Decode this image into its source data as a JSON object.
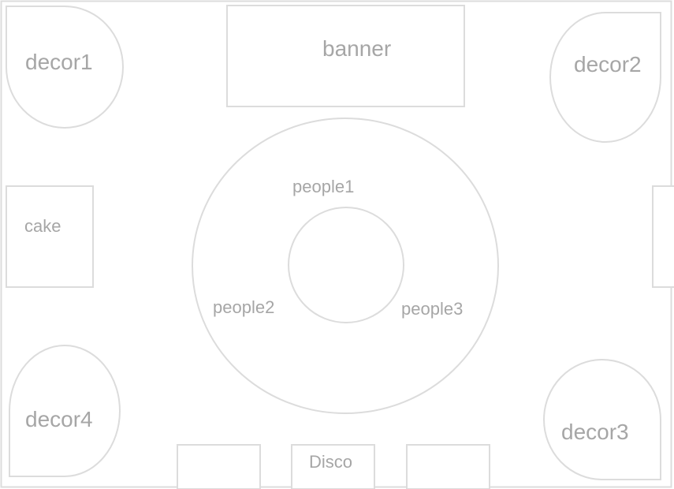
{
  "labels": {
    "decor1": "decor1",
    "decor2": "decor2",
    "decor3": "decor3",
    "decor4": "decor4",
    "banner": "banner",
    "cake": "cake",
    "people1": "people1",
    "people2": "people2",
    "people3": "people3",
    "disco": "Disco"
  },
  "colors": {
    "stroke": "#dcdcdc",
    "text": "#a6a6a6",
    "background": "#ffffff"
  }
}
